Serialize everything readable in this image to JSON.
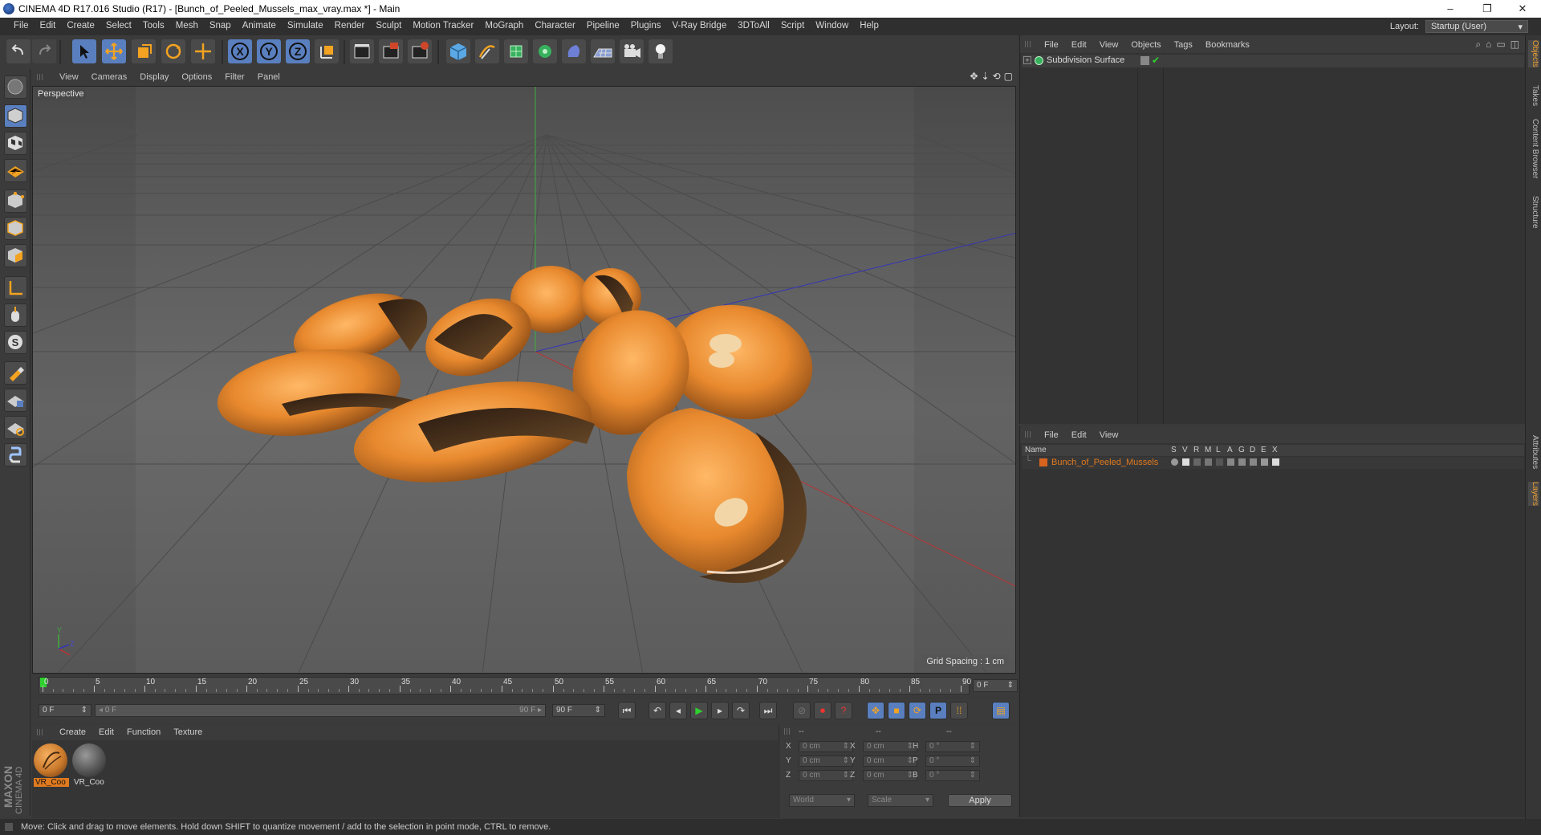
{
  "window": {
    "title": "CINEMA 4D R17.016 Studio (R17) - [Bunch_of_Peeled_Mussels_max_vray.max *] - Main",
    "controls": [
      "–",
      "❐",
      "✕"
    ]
  },
  "menubar": {
    "items": [
      "File",
      "Edit",
      "Create",
      "Select",
      "Tools",
      "Mesh",
      "Snap",
      "Animate",
      "Simulate",
      "Render",
      "Sculpt",
      "Motion Tracker",
      "MoGraph",
      "Character",
      "Pipeline",
      "Plugins",
      "V-Ray Bridge",
      "3DToAll",
      "Script",
      "Window",
      "Help"
    ],
    "layout_label": "Layout:",
    "layout_value": "Startup (User)"
  },
  "toolbar": {
    "axis_x": "X",
    "axis_y": "Y",
    "axis_z": "Z"
  },
  "viewport": {
    "menu": [
      "View",
      "Cameras",
      "Display",
      "Options",
      "Filter",
      "Panel"
    ],
    "label": "Perspective",
    "grid_spacing": "Grid Spacing : 1 cm",
    "axis_y": "Y",
    "axis_z": "Z"
  },
  "timeline": {
    "ticks": [
      "0",
      "5",
      "10",
      "15",
      "20",
      "25",
      "30",
      "35",
      "40",
      "45",
      "50",
      "55",
      "60",
      "65",
      "70",
      "75",
      "80",
      "85",
      "90"
    ],
    "current_frame": "0 F"
  },
  "transport": {
    "start_field": "0 F",
    "range_start": "0 F",
    "range_end": "90 F",
    "end_field": "90 F"
  },
  "material_manager": {
    "menu": [
      "Create",
      "Edit",
      "Function",
      "Texture"
    ],
    "materials": [
      {
        "label": "VR_Coo",
        "color": "#c9782a"
      },
      {
        "label": "VR_Coo",
        "color": "#555555"
      }
    ]
  },
  "coordinates": {
    "headers": [
      "--",
      "--",
      "--"
    ],
    "rows": [
      {
        "a": "X",
        "a_val": "0 cm",
        "b": "X",
        "b_val": "0 cm",
        "c": "H",
        "c_val": "0 °"
      },
      {
        "a": "Y",
        "a_val": "0 cm",
        "b": "Y",
        "b_val": "0 cm",
        "c": "P",
        "c_val": "0 °"
      },
      {
        "a": "Z",
        "a_val": "0 cm",
        "b": "Z",
        "b_val": "0 cm",
        "c": "B",
        "c_val": "0 °"
      }
    ],
    "mode1": "World",
    "mode2": "Scale",
    "apply": "Apply"
  },
  "object_manager": {
    "menu": [
      "File",
      "Edit",
      "View",
      "Objects",
      "Tags",
      "Bookmarks"
    ],
    "objects": [
      {
        "name": "Subdivision Surface"
      }
    ]
  },
  "layer_manager": {
    "menu": [
      "File",
      "Edit",
      "View"
    ],
    "columns": {
      "name": "Name",
      "flags": [
        "S",
        "V",
        "R",
        "M",
        "L",
        "A",
        "G",
        "D",
        "E",
        "X"
      ]
    },
    "layers": [
      {
        "name": "Bunch_of_Peeled_Mussels",
        "color": "#d9641e"
      }
    ]
  },
  "side_tabs": {
    "top": [
      "Objects",
      "Takes",
      "Content Browser",
      "Structure"
    ],
    "bottom": [
      "Attributes",
      "Layers"
    ]
  },
  "brand": {
    "maxon": "MAXON",
    "c4d": "CINEMA 4D"
  },
  "status": "Move: Click and drag to move elements. Hold down SHIFT to quantize movement / add to the selection in point mode, CTRL to remove.",
  "colors": {
    "accent_orange": "#e07a1f",
    "selection_blue": "#5a7fbf",
    "play_green": "#2fd12f"
  }
}
